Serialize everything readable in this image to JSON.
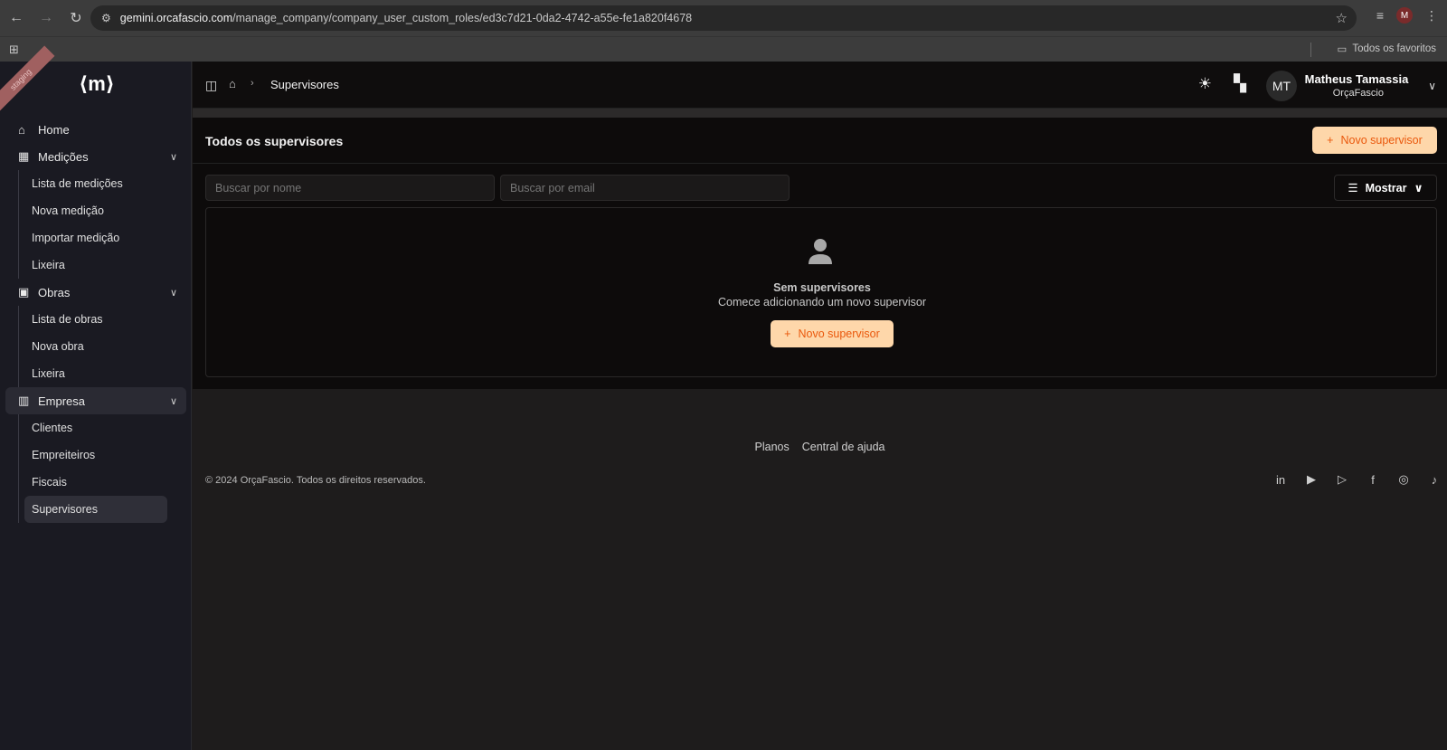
{
  "browser": {
    "url_domain": "gemini.orcafascio.com",
    "url_path": "/manage_company/company_user_custom_roles/ed3c7d21-0da2-4742-a55e-fe1a820f4678",
    "bookmarks_folder": "Todos os favoritos",
    "profile_initial": "M"
  },
  "sidebar": {
    "ribbon": "staging",
    "logo": "⟨m⟩",
    "items": [
      {
        "label": "Home"
      },
      {
        "label": "Medições",
        "children": [
          "Lista de medições",
          "Nova medição",
          "Importar medição",
          "Lixeira"
        ]
      },
      {
        "label": "Obras",
        "children": [
          "Lista de obras",
          "Nova obra",
          "Lixeira"
        ]
      },
      {
        "label": "Empresa",
        "children": [
          "Clientes",
          "Empreiteiros",
          "Fiscais",
          "Supervisores"
        ]
      }
    ]
  },
  "topbar": {
    "breadcrumb": "Supervisores",
    "avatar_initials": "MT",
    "user_name": "Matheus Tamassia",
    "user_org": "OrçaFascio"
  },
  "page": {
    "title": "Todos os supervisores",
    "new_button": "Novo supervisor",
    "search_name_placeholder": "Buscar por nome",
    "search_email_placeholder": "Buscar por email",
    "show_button": "Mostrar",
    "empty_title": "Sem supervisores",
    "empty_subtitle": "Comece adicionando um novo supervisor",
    "empty_button": "Novo supervisor"
  },
  "footer": {
    "links": [
      "Planos",
      "Central de ajuda"
    ],
    "copyright": "© 2024 OrçaFascio. Todos os direitos reservados."
  },
  "colors": {
    "accent_bg": "#fed7aa",
    "accent_text": "#ea580c"
  }
}
